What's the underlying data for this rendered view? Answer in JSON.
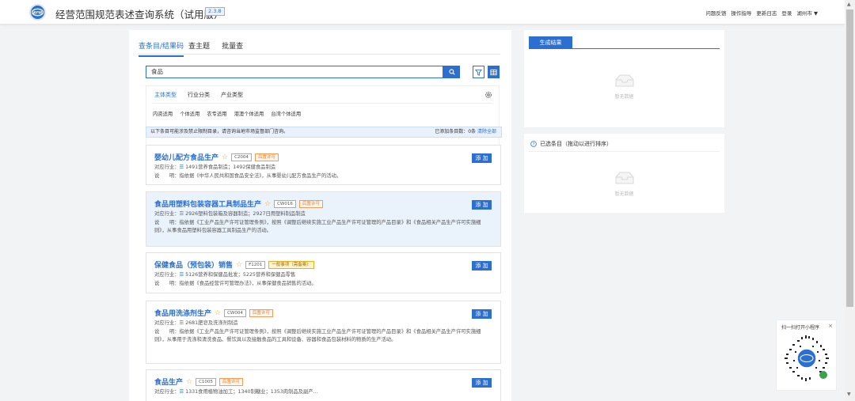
{
  "header": {
    "title": "经营范围规范表述查询系统（试用版）",
    "version": "2.3.8",
    "nav": [
      "问题反馈",
      "操作指导",
      "更新日志",
      "登录",
      "湖州市 ▼"
    ]
  },
  "tabs": [
    "查条目/结果码",
    "查主题",
    "批量查"
  ],
  "search": {
    "value": "食品"
  },
  "filter": {
    "subtabs": [
      "主体类型",
      "行业分类",
      "产业类型"
    ],
    "chips": [
      "内资适用",
      "个体适用",
      "农专适用",
      "港澳个体适用",
      "台湾个体适用"
    ]
  },
  "notice": {
    "text": "以下条目可能涉及禁止限制目录，请咨询当地市场监督部门咨询。",
    "added_label": "已添加条目数：0条",
    "clear": "清除全部"
  },
  "results": [
    {
      "title": "婴幼儿配方食品生产",
      "code": "C2004",
      "badge": "后置许可",
      "badge_type": "post",
      "industry_label": "对应行业：",
      "industry": "1491营养食品制造；1492保健食品制造",
      "desc_label": "说　　明：",
      "desc": "指依据《中华人民共和国食品安全法》，从事婴幼儿配方食品生产的活动。",
      "add": "添 加"
    },
    {
      "title": "食品用塑料包装容器工具制品生产",
      "code": "CW016",
      "badge": "后置许可",
      "badge_type": "post",
      "industry_label": "对应行业：",
      "industry": "2926塑料包装箱及容器制造；2927日用塑料制品制造",
      "desc_label": "说　　明：",
      "desc": "指依据《工业产品生产许可证管理条例》，按照《调整后继续实施工业产品生产许可证管理的产品目录》和《食品相关产品生产许可实施细则》，从事食品用塑料包装容器工具制品生产的活动。",
      "add": "添 加"
    },
    {
      "title": "保健食品（预包装）销售",
      "code": "F1201",
      "badge": "一般事项（需备案）",
      "badge_type": "general",
      "industry_label": "对应行业：",
      "industry": "5126营养和保健品批发；5225营养和保健品零售",
      "desc_label": "说　　明：",
      "desc": "指依据《食品经营许可管理办法》，从事保健食品销售的活动。",
      "add": "添 加"
    },
    {
      "title": "食品用洗涤剂生产",
      "code": "CW004",
      "badge": "后置许可",
      "badge_type": "post",
      "industry_label": "对应行业：",
      "industry": "2681肥皂及洗涤剂制造",
      "desc_label": "说　　明：",
      "desc": "指依据《工业产品生产许可证管理条例》，按照《调整后继续实施工业产品生产许可证管理的产品目录》和《食品相关产品生产许可实施细则》，从事用于洗涤和清洗食品、餐饮具以及接触食品的工具和设备、容器和食品包装材料的物质的生产活动。",
      "add": "添 加"
    },
    {
      "title": "食品生产",
      "code": "C1005",
      "badge": "后置许可",
      "badge_type": "post",
      "industry_label": "对应行业：",
      "industry": "1331食用植物油加工；1340制糖业；1353肉制品及副产…",
      "add": "添 加"
    }
  ],
  "right": {
    "gen_btn": "生成结果",
    "empty_text": "暂无数据",
    "selected_title": "已选条目（拖动以进行排序）"
  },
  "qr": {
    "title": "扫一扫打开小程序",
    "close": "×"
  },
  "colors": {
    "accent": "#2c6fd1",
    "badge_orange": "#f07d1d",
    "badge_yellow": "#e6b021",
    "highlight": "#eaf3fc"
  }
}
